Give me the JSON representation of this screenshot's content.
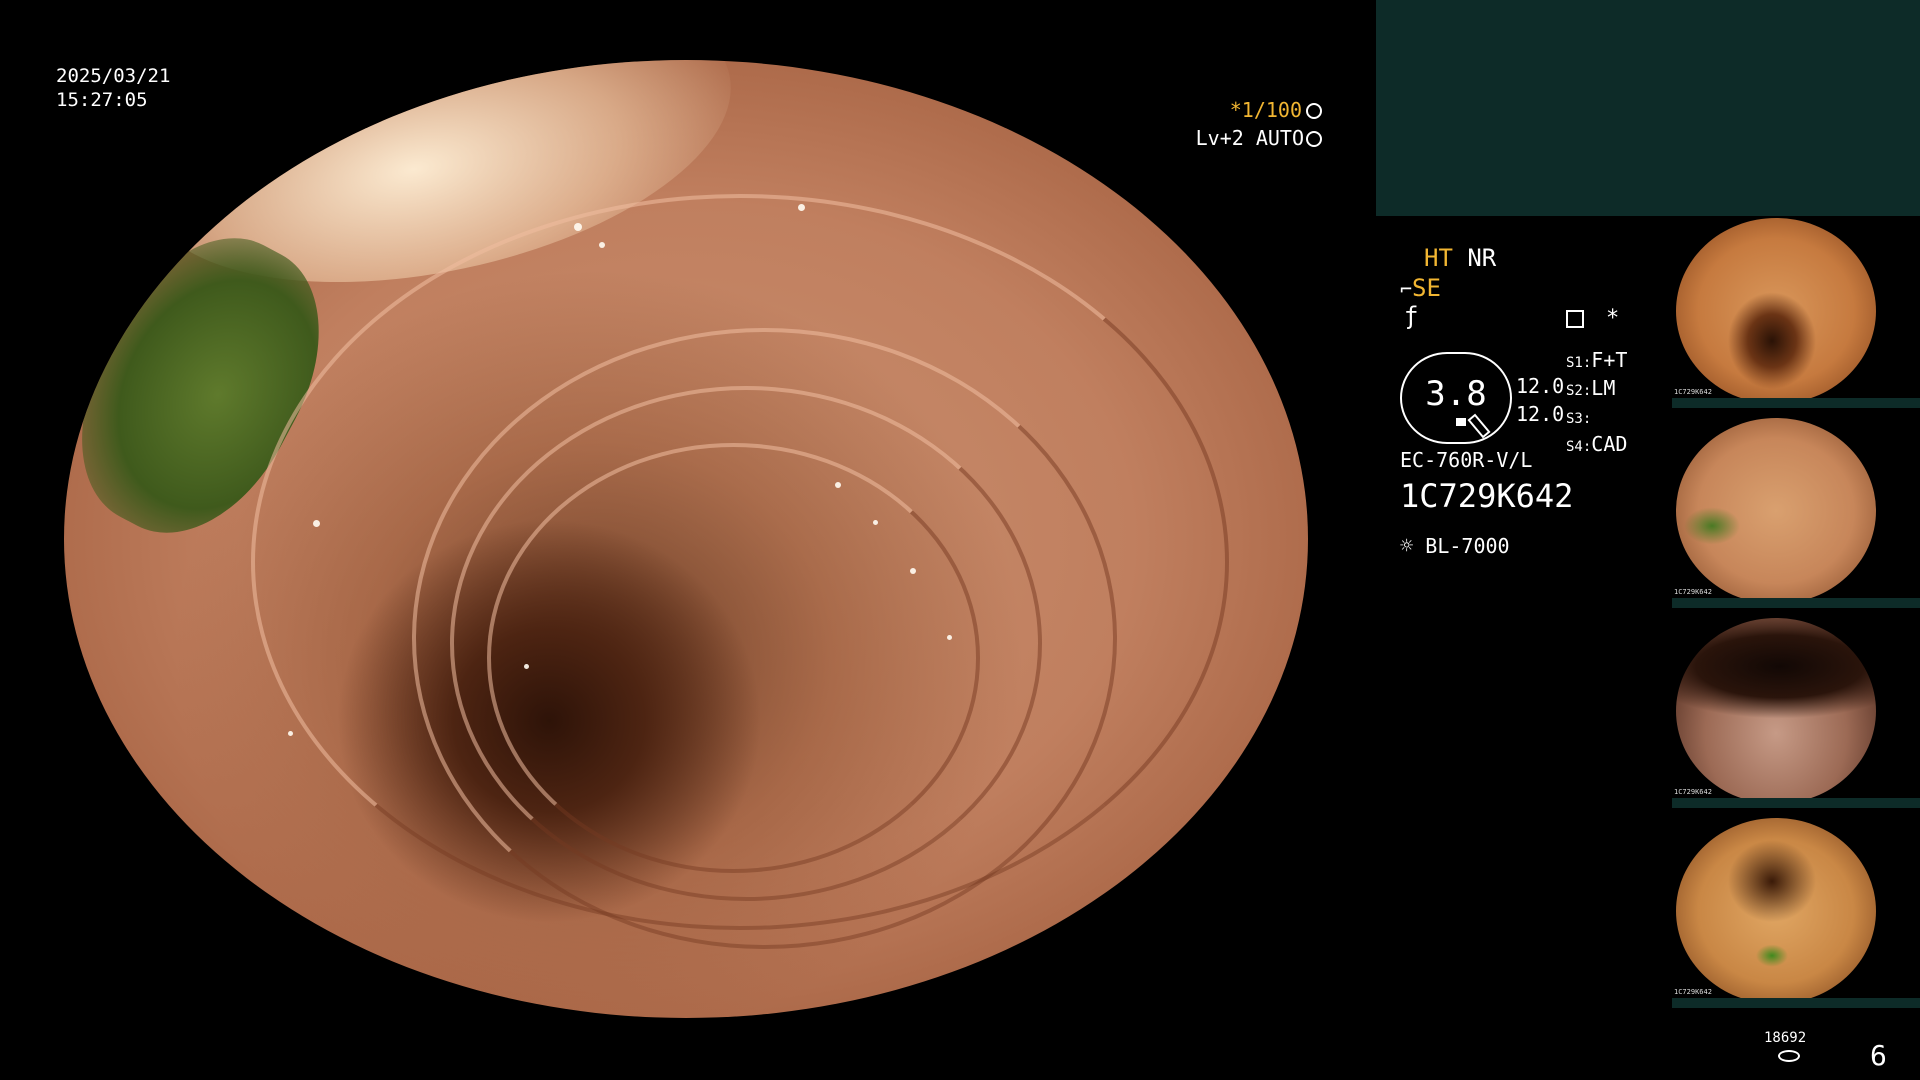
{
  "overlay": {
    "date": "2025/03/21",
    "time": "15:27:05",
    "shutter": "*1/100",
    "shutter_icon": "aperture-icon",
    "enhance": "Lv+2",
    "iris": "AUTO",
    "iris_icon": "iris-icon"
  },
  "settings": {
    "ht": "HT",
    "nr": "NR",
    "se": "SE",
    "star": "*",
    "zoom": "3.8",
    "value_1": "12.0",
    "value_2": "12.0",
    "switches": [
      {
        "key": "S1:",
        "value": "F+T"
      },
      {
        "key": "S2:",
        "value": "LM"
      },
      {
        "key": "S3:",
        "value": ""
      },
      {
        "key": "S4:",
        "value": "CAD"
      }
    ],
    "scope_model": "EC-760R-V/L",
    "serial": "1C729K642",
    "light_source": "BL-7000"
  },
  "footer": {
    "storage_count": "18692",
    "image_count": "6"
  },
  "thumbnails": [
    {
      "label": "1C729K642"
    },
    {
      "label": "1C729K642"
    },
    {
      "label": "1C729K642"
    },
    {
      "label": "1C729K642"
    }
  ],
  "colors": {
    "accent_yellow": "#f2b632",
    "panel_teal": "#0d2b28",
    "text_white": "#ffffff"
  }
}
